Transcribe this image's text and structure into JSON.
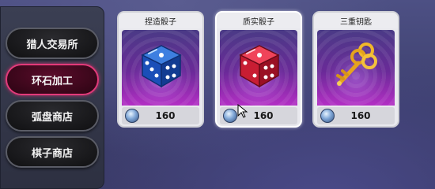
{
  "sidebar": {
    "items": [
      {
        "label": "猎人交易所",
        "active": false
      },
      {
        "label": "环石加工",
        "active": true
      },
      {
        "label": "弧盘商店",
        "active": false
      },
      {
        "label": "棋子商店",
        "active": false
      }
    ]
  },
  "shop": {
    "items": [
      {
        "name": "捏造骰子",
        "price": "160",
        "icon": "blue-dice-icon",
        "selected": false
      },
      {
        "name": "质实骰子",
        "price": "160",
        "icon": "red-dice-icon",
        "selected": true
      },
      {
        "name": "三重钥匙",
        "price": "160",
        "icon": "golden-key-icon",
        "selected": false
      }
    ],
    "currency_icon": "crystal-currency-icon"
  },
  "colors": {
    "active_border": "#e23a7a",
    "card_art_gradient_top": "#4a3a86",
    "card_art_gradient_bottom": "#b32fc4"
  }
}
